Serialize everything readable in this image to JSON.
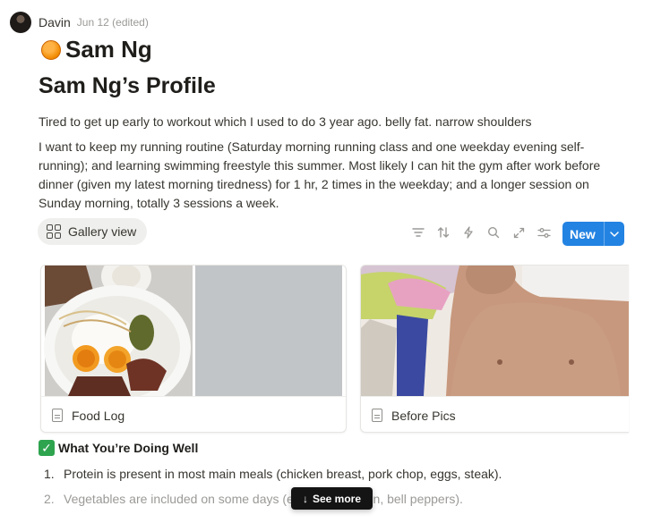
{
  "author": {
    "name": "Davin",
    "date": "Jun 12 (edited)"
  },
  "page": {
    "title": "Sam Ng",
    "icon": "orange-icon"
  },
  "heading": "Sam Ng’s Profile",
  "paragraphs": [
    "Tired to get up early to workout which I used to do 3 year ago. belly fat. narrow shoulders",
    "I want to keep my running routine (Saturday morning running class and one weekday evening self-running); and learning swimming freestyle this summer. Most likely I can hit the gym after work before dinner (given my latest morning tiredness) for 1 hr, 2 times in the weekday; and a longer session on Sunday morning, totally 3 sessions a week."
  ],
  "view": {
    "label": "Gallery view",
    "icon": "gallery-icon"
  },
  "toolbar": {
    "icons": [
      "filter-icon",
      "sort-icon",
      "automation-icon",
      "search-icon",
      "expand-icon",
      "settings-icon"
    ],
    "new_label": "New"
  },
  "cards": [
    {
      "title": "Food Log",
      "icon": "page-icon"
    },
    {
      "title": "Before Pics",
      "icon": "page-icon"
    }
  ],
  "section": {
    "title": "What You’re Doing Well",
    "icon": "check-icon"
  },
  "list": [
    {
      "num": "1.",
      "text": "Protein is present in most main meals (chicken breast, pork chop, eggs, steak)."
    },
    {
      "num": "2.",
      "text": "Vegetables are included on some days (e.g., bitter melon, bell peppers)."
    }
  ],
  "see_more": {
    "label": "See more"
  },
  "colors": {
    "accent": "#2383e2",
    "check": "#2ea44f"
  }
}
